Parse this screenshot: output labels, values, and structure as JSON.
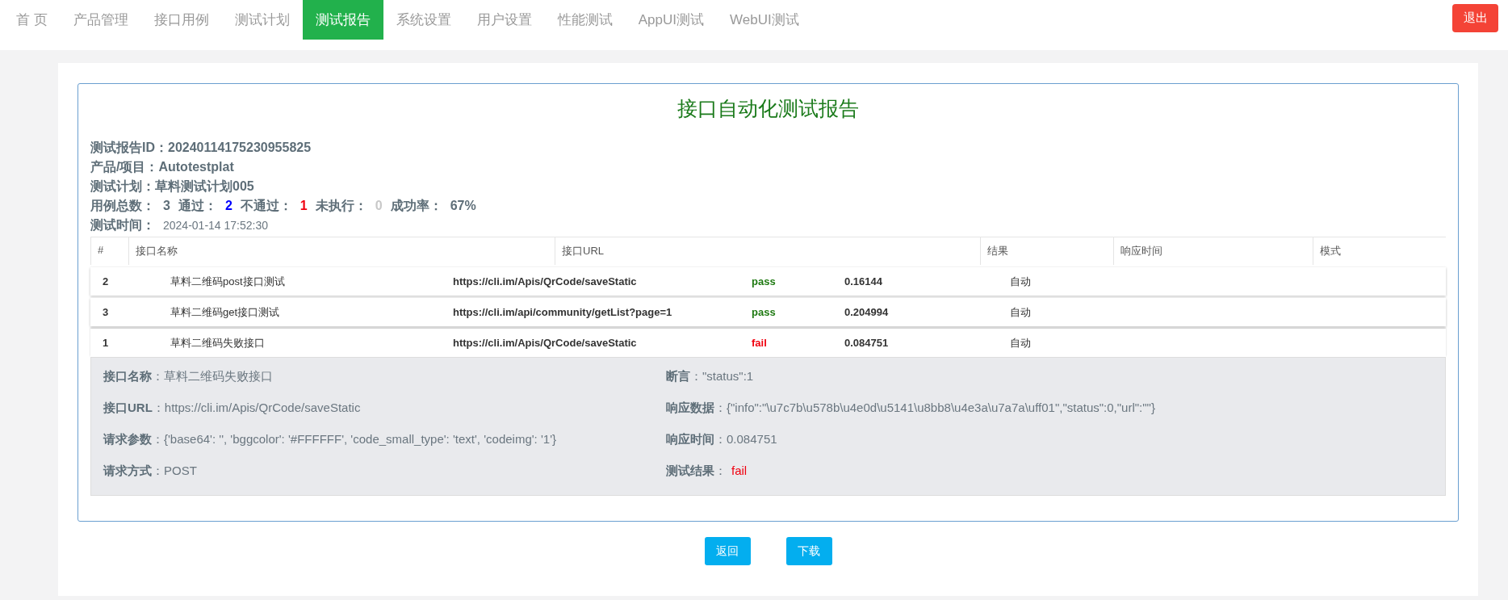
{
  "nav": {
    "tabs": [
      {
        "label": "首 页",
        "selected": false
      },
      {
        "label": "产品管理",
        "selected": false
      },
      {
        "label": "接口用例",
        "selected": false
      },
      {
        "label": "测试计划",
        "selected": false
      },
      {
        "label": "测试报告",
        "selected": true
      },
      {
        "label": "系统设置",
        "selected": false
      },
      {
        "label": "用户设置",
        "selected": false
      },
      {
        "label": "性能测试",
        "selected": false
      },
      {
        "label": "AppUI测试",
        "selected": false
      },
      {
        "label": "WebUI测试",
        "selected": false
      }
    ],
    "logout": "退出"
  },
  "report": {
    "title": "接口自动化测试报告",
    "info": [
      {
        "label": "测试报告ID：",
        "value": "20240114175230955825"
      },
      {
        "label": "产品/项目：",
        "value": "Autotestplat"
      },
      {
        "label": "测试计划：",
        "value": "草料测试计划005"
      }
    ],
    "summary": [
      {
        "label": "用例总数：",
        "value": "3",
        "kind": "total"
      },
      {
        "label": "通过：",
        "value": "2",
        "kind": "pass"
      },
      {
        "label": "不通过：",
        "value": "1",
        "kind": "fail"
      },
      {
        "label": "未执行：",
        "value": "0",
        "kind": "skip"
      },
      {
        "label": "成功率：",
        "value": "67%",
        "kind": "total"
      }
    ],
    "time": {
      "label": "测试时间：",
      "value": "2024-01-14 17:52:30"
    },
    "table": {
      "columns": [
        "#",
        "接口名称",
        "接口URL",
        "结果",
        "响应时间",
        "模式"
      ],
      "rows": [
        {
          "index": "2",
          "name": "草料二维码post接口测试",
          "url": "https://cli.im/Apis/QrCode/saveStatic",
          "result": "pass",
          "kind": "pass",
          "time": "0.16144",
          "mode": "自动",
          "expanded": false
        },
        {
          "index": "3",
          "name": "草料二维码get接口测试",
          "url": "https://cli.im/api/community/getList?page=1",
          "result": "pass",
          "kind": "pass",
          "time": "0.204994",
          "mode": "自动",
          "expanded": false
        },
        {
          "index": "1",
          "name": "草料二维码失败接口",
          "url": "https://cli.im/Apis/QrCode/saveStatic",
          "result": "fail",
          "kind": "fail",
          "time": "0.084751",
          "mode": "自动",
          "expanded": true,
          "detail": [
            {
              "label": "接口名称",
              "sep": "：",
              "value": "草料二维码失败接口",
              "kind": "text"
            },
            {
              "label": "断言",
              "sep": "：",
              "value": "\"status\":1",
              "kind": "text"
            },
            {
              "label": "接口URL",
              "sep": "：",
              "value": "https://cli.im/Apis/QrCode/saveStatic",
              "kind": "text"
            },
            {
              "label": "响应数据",
              "sep": "：",
              "value": "{\"info\":\"\\u7c7b\\u578b\\u4e0d\\u5141\\u8bb8\\u4e3a\\u7a7a\\uff01\",\"status\":0,\"url\":\"\"}",
              "kind": "text"
            },
            {
              "label": "请求参数",
              "sep": "：",
              "value": "{'base64': '', 'bggcolor': '#FFFFFF', 'code_small_type': 'text', 'codeimg': '1'}",
              "kind": "text"
            },
            {
              "label": "响应时间",
              "sep": "：",
              "value": "0.084751",
              "kind": "text"
            },
            {
              "label": "请求方式",
              "sep": "：",
              "value": "POST",
              "kind": "text"
            },
            {
              "label": "测试结果",
              "sep": "：",
              "value": "fail",
              "kind": "fail"
            }
          ]
        }
      ]
    }
  },
  "buttons": [
    "返回",
    "下载"
  ]
}
